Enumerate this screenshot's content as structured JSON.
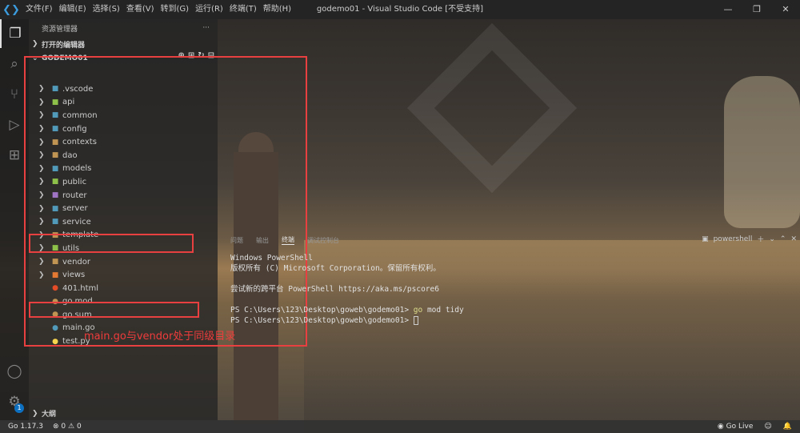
{
  "titlebar": {
    "menu": [
      "文件(F)",
      "编辑(E)",
      "选择(S)",
      "查看(V)",
      "转到(G)",
      "运行(R)",
      "终端(T)",
      "帮助(H)"
    ],
    "title": "godemo01 - Visual Studio Code [不受支持]"
  },
  "sidebar": {
    "header": "资源管理器",
    "more": "···",
    "open_editors": "打开的编辑器",
    "project": "GODEMO01",
    "outline": "大纲",
    "tree": [
      {
        "label": ".vscode",
        "type": "folder",
        "color": "#519aba"
      },
      {
        "label": "api",
        "type": "folder",
        "color": "#8dc149"
      },
      {
        "label": "common",
        "type": "folder",
        "color": "#519aba"
      },
      {
        "label": "config",
        "type": "folder",
        "color": "#519aba"
      },
      {
        "label": "contexts",
        "type": "folder",
        "color": "#c09553"
      },
      {
        "label": "dao",
        "type": "folder",
        "color": "#c09553"
      },
      {
        "label": "models",
        "type": "folder",
        "color": "#519aba"
      },
      {
        "label": "public",
        "type": "folder",
        "color": "#8dc149"
      },
      {
        "label": "router",
        "type": "folder",
        "color": "#a074c4"
      },
      {
        "label": "server",
        "type": "folder",
        "color": "#519aba"
      },
      {
        "label": "service",
        "type": "folder",
        "color": "#519aba"
      },
      {
        "label": "template",
        "type": "folder",
        "color": "#c09553"
      },
      {
        "label": "utils",
        "type": "folder",
        "color": "#8dc149"
      },
      {
        "label": "vendor",
        "type": "folder",
        "color": "#c09553"
      },
      {
        "label": "views",
        "type": "folder",
        "color": "#e37933"
      },
      {
        "label": "401.html",
        "type": "file",
        "color": "#e34c26"
      },
      {
        "label": "go.mod",
        "type": "file",
        "color": "#c09553"
      },
      {
        "label": "go.sum",
        "type": "file",
        "color": "#c09553"
      },
      {
        "label": "main.go",
        "type": "file",
        "color": "#519aba"
      },
      {
        "label": "test.py",
        "type": "file",
        "color": "#f7d44e"
      }
    ]
  },
  "annotation": "main.go与vendor处于同级目录",
  "panel": {
    "tabs": [
      "问题",
      "输出",
      "终端",
      "调试控制台"
    ],
    "active_tab": "终端",
    "shell": "powershell",
    "lines": [
      "Windows PowerShell",
      "版权所有 (C) Microsoft Corporation。保留所有权利。",
      "",
      "尝试新的跨平台 PowerShell https://aka.ms/pscore6",
      "",
      "PS C:\\Users\\123\\Desktop\\goweb\\godemo01> ",
      "PS C:\\Users\\123\\Desktop\\goweb\\godemo01> "
    ],
    "command_go": "go",
    "command_rest": " mod tidy"
  },
  "status": {
    "go_version": "Go 1.17.3",
    "errors": "0",
    "warnings": "0",
    "go_live": "Go Live",
    "notification_count": "1"
  },
  "colors": {
    "accent": "#0e70c0",
    "annotation": "#e84040"
  }
}
